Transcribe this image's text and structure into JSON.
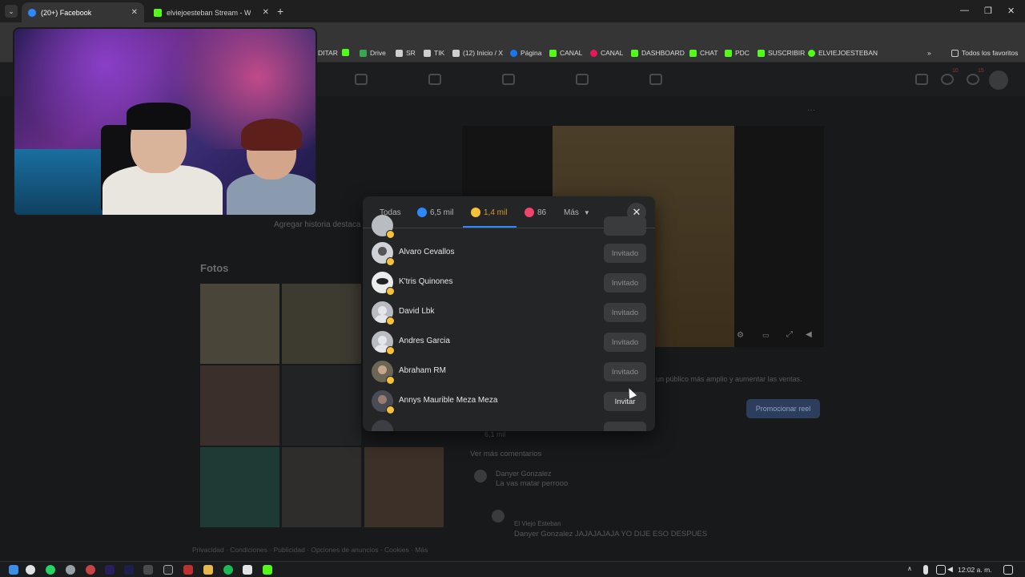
{
  "browser": {
    "tabs": [
      {
        "title": "(20+) Facebook",
        "active": true
      },
      {
        "title": "elviejoesteban Stream - Watch",
        "active": false
      }
    ],
    "bookmarks": [
      {
        "label": "DITAR",
        "color": "#cfcfcf"
      },
      {
        "label": "Drive",
        "color": "#34a853"
      },
      {
        "label": "SR",
        "color": "#cfcfcf"
      },
      {
        "label": "TIK",
        "color": "#cfcfcf"
      },
      {
        "label": "(12) Inicio / X",
        "color": "#cfcfcf"
      },
      {
        "label": "Página",
        "color": "#1877f2"
      },
      {
        "label": "CANAL",
        "color": "#53fc18"
      },
      {
        "label": "CANAL",
        "color": "#e8185a"
      },
      {
        "label": "DASHBOARD",
        "color": "#53fc18"
      },
      {
        "label": "CHAT",
        "color": "#53fc18"
      },
      {
        "label": "PDC",
        "color": "#53fc18"
      },
      {
        "label": "SUSCRIBIR",
        "color": "#53fc18"
      },
      {
        "label": "ELVIEJOESTEBAN",
        "color": "#53fc18"
      }
    ],
    "all_favorites": "Todos los favoritos"
  },
  "fb": {
    "photos_title": "Fotos",
    "add_history": "Agregar historia destaca",
    "promote_button": "Promocionar reel",
    "promo_text": "un público más amplio y aumentar las ventas.",
    "stats": "6,1 mil",
    "more_comments": "Ver más comentarios",
    "comment1_author": "Danyer Gonzalez",
    "comment1_text": "La vas matar perrooo",
    "comment2_meta": "El Viejo Esteban",
    "comment2_text": "Danyer Gonzalez JAJAJAJAJA YO DIJE ESO DESPUES",
    "footer": "Privacidad · Condiciones · Publicidad · Opciones de anuncios · Cookies · Más",
    "notif_counts": [
      "10",
      "15"
    ]
  },
  "modal": {
    "tabs": [
      {
        "label": "Todas"
      },
      {
        "label": "6,5 mil",
        "reaction": "like"
      },
      {
        "label": "1,4 mil",
        "reaction": "haha"
      },
      {
        "label": "86",
        "reaction": "love"
      },
      {
        "label": "Más"
      }
    ],
    "people": [
      {
        "name": "Alvaro Cevallos",
        "button": "Invitado",
        "invited": true
      },
      {
        "name": "K'tris Quinones",
        "button": "Invitado",
        "invited": true
      },
      {
        "name": "David Lbk",
        "button": "Invitado",
        "invited": true
      },
      {
        "name": "Andres Garcia",
        "button": "Invitado",
        "invited": true
      },
      {
        "name": "Abraham RM",
        "button": "Invitado",
        "invited": true
      },
      {
        "name": "Annys Mauriblе Meza Meza",
        "button": "Invitar",
        "invited": false
      }
    ]
  },
  "taskbar": {
    "clock": "12:02 a. m."
  }
}
